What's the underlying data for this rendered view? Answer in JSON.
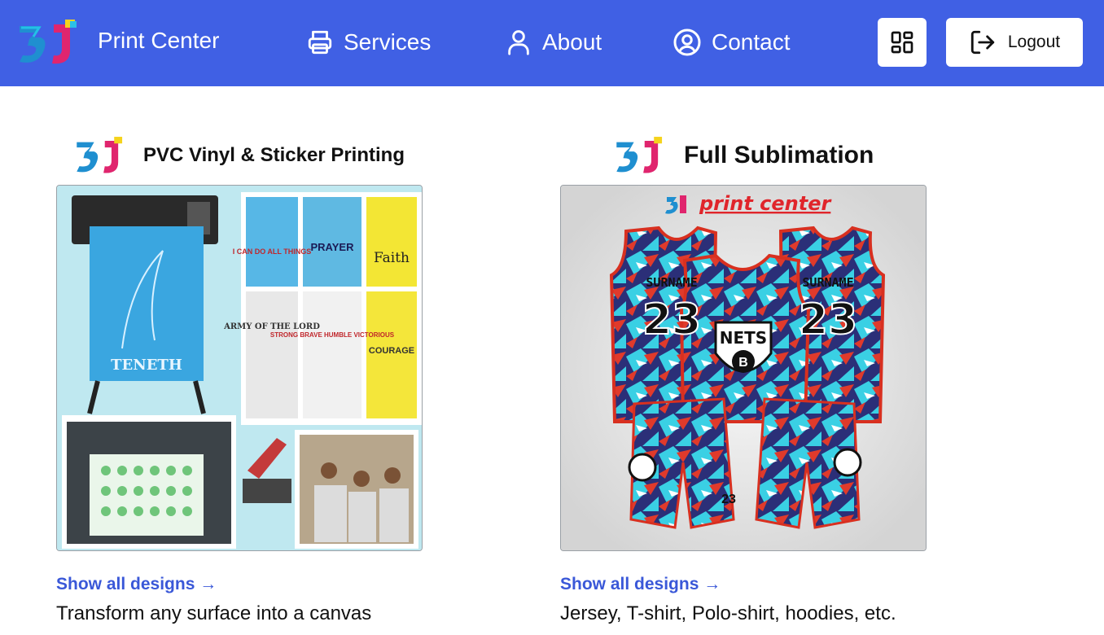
{
  "header": {
    "brand": "Print Center",
    "nav": [
      {
        "label": "Services",
        "icon": "printer-icon"
      },
      {
        "label": "About",
        "icon": "user-icon"
      },
      {
        "label": "Contact",
        "icon": "contact-icon"
      }
    ],
    "grid_icon": "grid-icon",
    "logout_label": "Logout",
    "colors": {
      "bar": "#4060e4",
      "link": "#3a58d8"
    }
  },
  "cards": [
    {
      "title": "PVC Vinyl & Sticker Printing",
      "image": {
        "shirt_texts": [
          "I CAN DO ALL THINGS",
          "PRAYER",
          "Faith",
          "ARMY OF THE LORD",
          "STRONG BRAVE HUMBLE VICTORIOUS",
          "COURAGE"
        ],
        "banner_text": "TENETH"
      },
      "link": "Show all designs →",
      "description": "Transform any surface into a canvas"
    },
    {
      "title": "Full Sublimation",
      "image": {
        "watermark": "print center",
        "jersey_name": "SURNAME",
        "jersey_number": "23",
        "team": "NETS"
      },
      "link": "Show all designs →",
      "description": "Jersey, T-shirt, Polo-shirt, hoodies, etc."
    }
  ]
}
